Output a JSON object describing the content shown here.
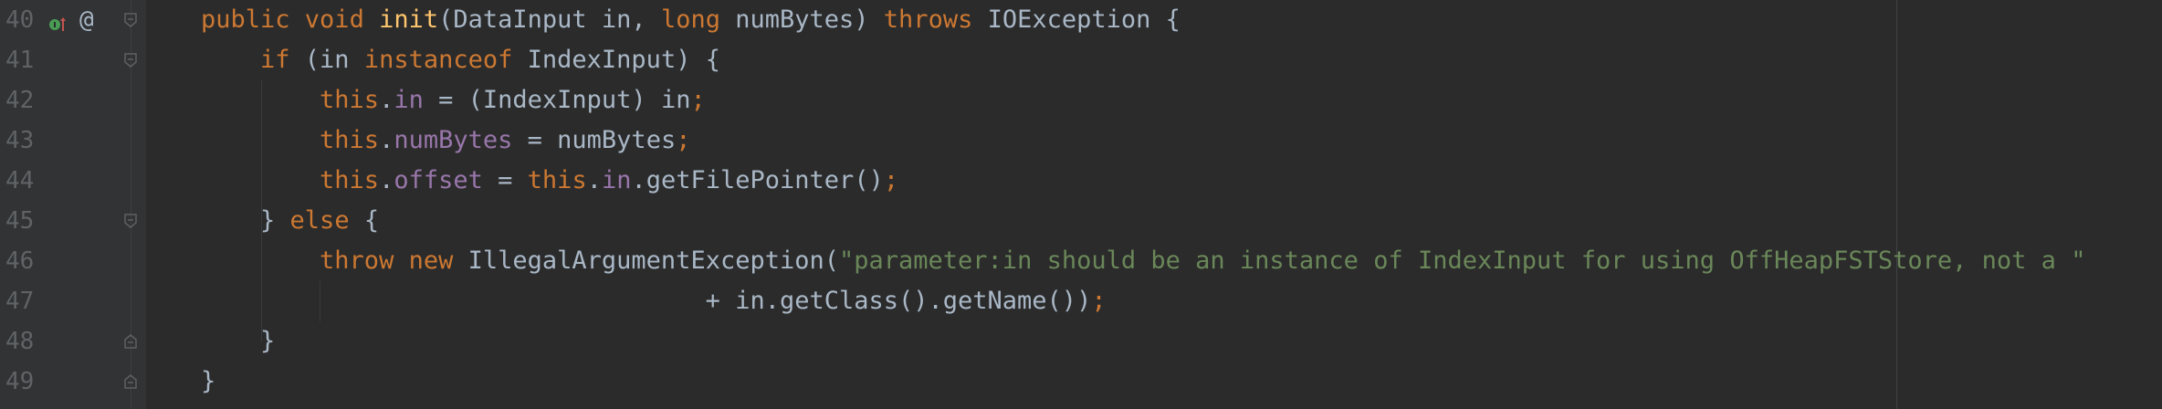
{
  "editor": {
    "language": "Java",
    "colors": {
      "background": "#2b2b2b",
      "keyword": "#cc7832",
      "method": "#ffc66d",
      "field": "#9876aa",
      "string": "#6a8759",
      "text": "#a9b7c6",
      "line_number": "#606366"
    },
    "gutter_icons": {
      "implementation_marker": "implements-up-arrow-icon",
      "annotation_marker": "at-sign-icon"
    },
    "lines": [
      {
        "number": "40",
        "tokens": [
          {
            "t": "public ",
            "c": "kw"
          },
          {
            "t": "void ",
            "c": "kw"
          },
          {
            "t": "init",
            "c": "fn"
          },
          {
            "t": "(DataInput in, ",
            "c": "plain"
          },
          {
            "t": "long ",
            "c": "kw"
          },
          {
            "t": "numBytes) ",
            "c": "plain"
          },
          {
            "t": "throws ",
            "c": "kw"
          },
          {
            "t": "IOException {",
            "c": "plain"
          }
        ]
      },
      {
        "number": "41",
        "tokens": [
          {
            "t": "    if ",
            "c": "kw"
          },
          {
            "t": "(in ",
            "c": "plain"
          },
          {
            "t": "instanceof ",
            "c": "kw"
          },
          {
            "t": "IndexInput) {",
            "c": "plain"
          }
        ]
      },
      {
        "number": "42",
        "tokens": [
          {
            "t": "        this",
            "c": "kw"
          },
          {
            "t": ".",
            "c": "plain"
          },
          {
            "t": "in",
            "c": "fld"
          },
          {
            "t": " = (IndexInput) in",
            "c": "plain"
          },
          {
            "t": ";",
            "c": "kw"
          }
        ]
      },
      {
        "number": "43",
        "tokens": [
          {
            "t": "        this",
            "c": "kw"
          },
          {
            "t": ".",
            "c": "plain"
          },
          {
            "t": "numBytes",
            "c": "fld"
          },
          {
            "t": " = numBytes",
            "c": "plain"
          },
          {
            "t": ";",
            "c": "kw"
          }
        ]
      },
      {
        "number": "44",
        "tokens": [
          {
            "t": "        this",
            "c": "kw"
          },
          {
            "t": ".",
            "c": "plain"
          },
          {
            "t": "offset",
            "c": "fld"
          },
          {
            "t": " = ",
            "c": "plain"
          },
          {
            "t": "this",
            "c": "kw"
          },
          {
            "t": ".",
            "c": "plain"
          },
          {
            "t": "in",
            "c": "fld"
          },
          {
            "t": ".getFilePointer()",
            "c": "plain"
          },
          {
            "t": ";",
            "c": "kw"
          }
        ]
      },
      {
        "number": "45",
        "tokens": [
          {
            "t": "    } ",
            "c": "plain"
          },
          {
            "t": "else ",
            "c": "kw"
          },
          {
            "t": "{",
            "c": "plain"
          }
        ]
      },
      {
        "number": "46",
        "tokens": [
          {
            "t": "        throw ",
            "c": "kw"
          },
          {
            "t": "new ",
            "c": "kw"
          },
          {
            "t": "IllegalArgumentException(",
            "c": "plain"
          },
          {
            "t": "\"parameter:in should be an instance of IndexInput for using OffHeapFSTStore, not a \"",
            "c": "str"
          }
        ]
      },
      {
        "number": "47",
        "tokens": [
          {
            "t": "                                  + in.getClass().getName())",
            "c": "plain"
          },
          {
            "t": ";",
            "c": "kw"
          }
        ]
      },
      {
        "number": "48",
        "tokens": [
          {
            "t": "    }",
            "c": "plain"
          }
        ]
      },
      {
        "number": "49",
        "tokens": [
          {
            "t": "}",
            "c": "plain"
          }
        ]
      }
    ]
  }
}
